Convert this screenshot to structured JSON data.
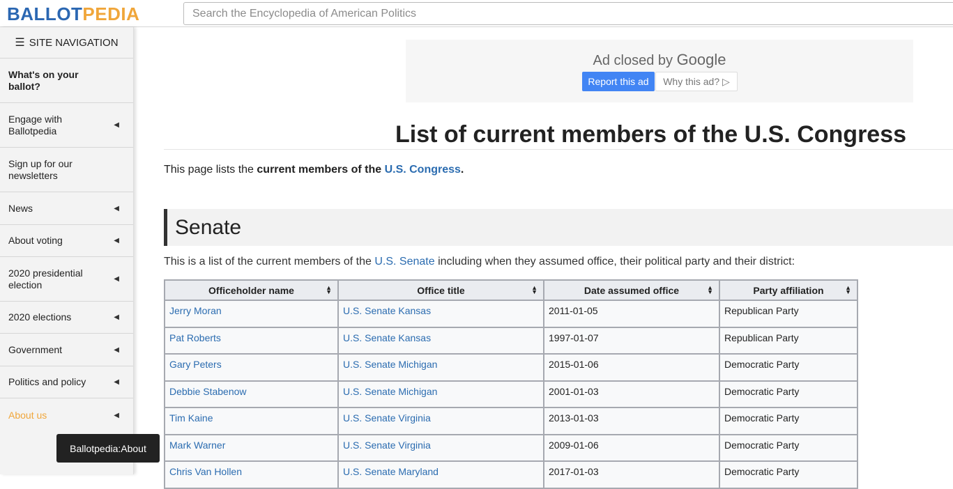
{
  "header": {
    "logo_part1": "BALLOT",
    "logo_part2": "PEDIA",
    "search_placeholder": "Search the Encyclopedia of American Politics"
  },
  "sidebar": {
    "heading": "SITE NAVIGATION",
    "items": [
      {
        "label": "What's on your ballot?",
        "has_arrow": false
      },
      {
        "label": "Engage with Ballotpedia",
        "has_arrow": true
      },
      {
        "label": "Sign up for our newsletters",
        "has_arrow": false
      },
      {
        "label": "News",
        "has_arrow": true
      },
      {
        "label": "About voting",
        "has_arrow": true
      },
      {
        "label": "2020 presidential election",
        "has_arrow": true
      },
      {
        "label": "2020 elections",
        "has_arrow": true
      },
      {
        "label": "Government",
        "has_arrow": true
      },
      {
        "label": "Politics and policy",
        "has_arrow": true
      },
      {
        "label": "About us",
        "has_arrow": true
      }
    ],
    "tooltip": "Ballotpedia:About"
  },
  "ad": {
    "closed_text": "Ad closed by",
    "google": "Google",
    "report_label": "Report this ad",
    "why_label": "Why this ad? ▷"
  },
  "page": {
    "title": "List of current members of the U.S. Congress",
    "intro_pre": "This page lists the ",
    "intro_bold": "current members of the ",
    "intro_link": "U.S. Congress",
    "intro_post": "."
  },
  "senate": {
    "heading": "Senate",
    "text_pre": "This is a list of the current members of the ",
    "text_link": "U.S. Senate",
    "text_post": " including when they assumed office, their political party and their district:",
    "columns": [
      "Officeholder name",
      "Office title",
      "Date assumed office",
      "Party affiliation"
    ],
    "rows": [
      {
        "name": "Jerry Moran",
        "office": "U.S. Senate Kansas",
        "date": "2011-01-05",
        "party": "Republican Party"
      },
      {
        "name": "Pat Roberts",
        "office": "U.S. Senate Kansas",
        "date": "1997-01-07",
        "party": "Republican Party"
      },
      {
        "name": "Gary Peters",
        "office": "U.S. Senate Michigan",
        "date": "2015-01-06",
        "party": "Democratic Party"
      },
      {
        "name": "Debbie Stabenow",
        "office": "U.S. Senate Michigan",
        "date": "2001-01-03",
        "party": "Democratic Party"
      },
      {
        "name": "Tim Kaine",
        "office": "U.S. Senate Virginia",
        "date": "2013-01-03",
        "party": "Democratic Party"
      },
      {
        "name": "Mark Warner",
        "office": "U.S. Senate Virginia",
        "date": "2009-01-06",
        "party": "Democratic Party"
      },
      {
        "name": "Chris Van Hollen",
        "office": "U.S. Senate Maryland",
        "date": "2017-01-03",
        "party": "Democratic Party"
      }
    ]
  },
  "colors": {
    "brand_blue": "#2b67b2",
    "brand_orange": "#f0a63a",
    "link": "#2b6cb0",
    "ad_button": "#4285f4"
  }
}
